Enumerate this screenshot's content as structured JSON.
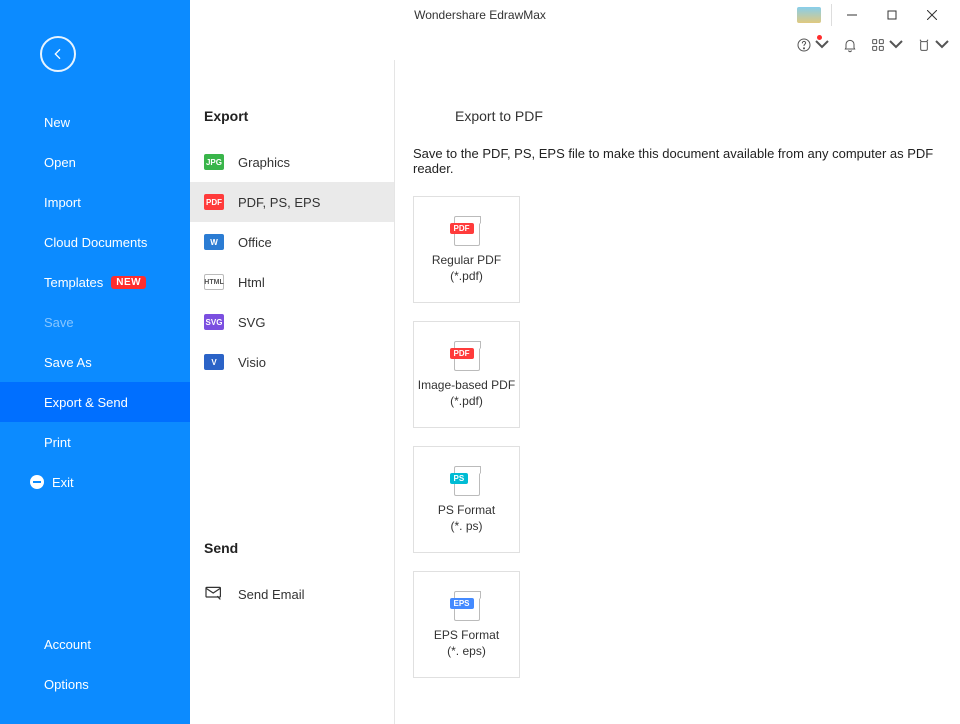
{
  "titlebar": {
    "title": "Wondershare EdrawMax"
  },
  "sidebar": {
    "items": [
      {
        "label": "New"
      },
      {
        "label": "Open"
      },
      {
        "label": "Import"
      },
      {
        "label": "Cloud Documents"
      },
      {
        "label": "Templates",
        "badge": "NEW"
      },
      {
        "label": "Save"
      },
      {
        "label": "Save As"
      },
      {
        "label": "Export & Send"
      },
      {
        "label": "Print"
      },
      {
        "label": "Exit"
      }
    ],
    "bottom": [
      {
        "label": "Account"
      },
      {
        "label": "Options"
      }
    ]
  },
  "export": {
    "title": "Export",
    "items": [
      {
        "label": "Graphics",
        "icon": "JPG"
      },
      {
        "label": "PDF, PS, EPS",
        "icon": "PDF"
      },
      {
        "label": "Office",
        "icon": "W"
      },
      {
        "label": "Html",
        "icon": "HTML"
      },
      {
        "label": "SVG",
        "icon": "SVG"
      },
      {
        "label": "Visio",
        "icon": "V"
      }
    ]
  },
  "send": {
    "title": "Send",
    "items": [
      {
        "label": "Send Email"
      }
    ]
  },
  "content": {
    "heading": "Export to PDF",
    "description": "Save to the PDF, PS, EPS file to make this document available from any computer as PDF reader.",
    "options": [
      {
        "title": "Regular PDF",
        "subtitle": "(*.pdf)",
        "tag": "PDF"
      },
      {
        "title": "Image-based PDF",
        "subtitle": "(*.pdf)",
        "tag": "PDF"
      },
      {
        "title": "PS Format",
        "subtitle": "(*. ps)",
        "tag": "PS"
      },
      {
        "title": "EPS Format",
        "subtitle": "(*. eps)",
        "tag": "EPS"
      }
    ]
  }
}
